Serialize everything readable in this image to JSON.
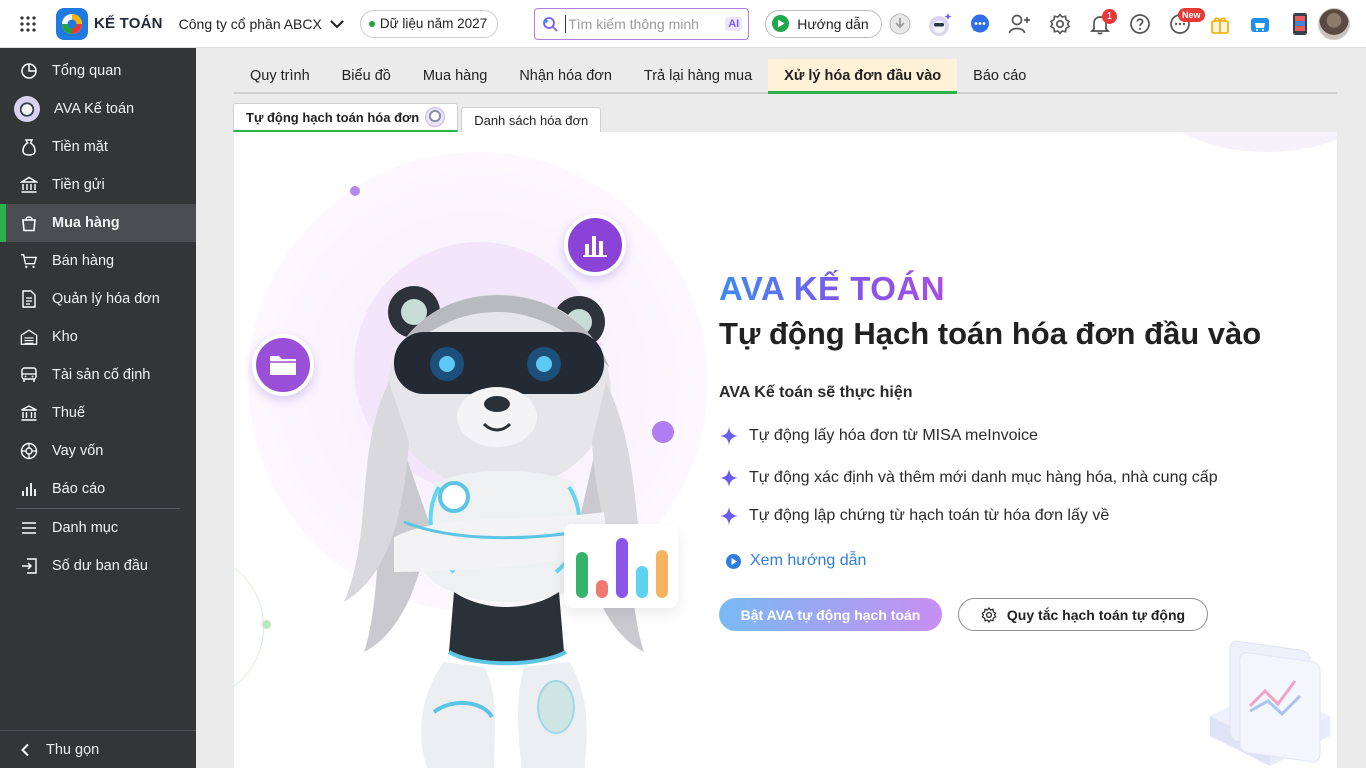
{
  "app": {
    "brand": "KẾ TOÁN",
    "company": "Công ty cổ phần ABCX",
    "year_label": "Dữ liệu năm 2027",
    "search_placeholder": "Tìm kiếm thông minh",
    "ai_badge": "AI",
    "guide_label": "Hướng dẫn",
    "notification_count": "1",
    "new_badge": "New"
  },
  "sidebar": {
    "items": [
      {
        "label": "Tổng quan",
        "icon": "clock-chart-icon"
      },
      {
        "label": "AVA Kế toán",
        "icon": "ava-avatar-icon"
      },
      {
        "label": "Tiền mặt",
        "icon": "money-bag-icon"
      },
      {
        "label": "Tiền gửi",
        "icon": "bank-icon"
      },
      {
        "label": "Mua hàng",
        "icon": "shopping-bag-icon",
        "active": true
      },
      {
        "label": "Bán hàng",
        "icon": "cart-icon"
      },
      {
        "label": "Quản lý hóa đơn",
        "icon": "invoice-icon"
      },
      {
        "label": "Kho",
        "icon": "warehouse-icon"
      },
      {
        "label": "Tài sản cố định",
        "icon": "vehicle-icon"
      },
      {
        "label": "Thuế",
        "icon": "tax-building-icon"
      },
      {
        "label": "Vay vốn",
        "icon": "loan-icon"
      },
      {
        "label": "Báo cáo",
        "icon": "bar-chart-icon"
      },
      {
        "label": "Danh mục",
        "icon": "list-icon"
      },
      {
        "label": "Số dư ban đầu",
        "icon": "import-icon"
      }
    ],
    "collapse_label": "Thu gọn"
  },
  "tabs": [
    {
      "label": "Quy trình"
    },
    {
      "label": "Biểu đồ"
    },
    {
      "label": "Mua hàng"
    },
    {
      "label": "Nhận hóa đơn"
    },
    {
      "label": "Trả lại hàng mua"
    },
    {
      "label": "Xử lý hóa đơn đầu vào",
      "active": true
    },
    {
      "label": "Báo cáo"
    }
  ],
  "subtabs": [
    {
      "label": "Tự động hạch toán hóa đơn",
      "active": true
    },
    {
      "label": "Danh sách hóa đơn"
    }
  ],
  "hero": {
    "title_brand": "AVA KẾ TOÁN",
    "title_main": "Tự động Hạch toán hóa đơn đầu vào",
    "subheading": "AVA Kế toán sẽ thực hiện",
    "features": [
      "Tự động lấy hóa đơn từ MISA meInvoice",
      "Tự động xác định và thêm mới danh mục hàng hóa, nhà cung cấp",
      "Tự động lập chứng từ hạch toán từ hóa đơn lấy về"
    ],
    "howto_link": "Xem hướng dẫn",
    "primary_button": "Bật AVA tự động hạch toán",
    "secondary_button": "Quy tắc hạch toán tự động"
  },
  "colors": {
    "accent_green": "#2bb24c",
    "sidebar_bg": "#333537",
    "brand_gradient_start": "#3b8df0",
    "brand_gradient_end": "#a94ee6",
    "link_blue": "#2e7de0"
  }
}
